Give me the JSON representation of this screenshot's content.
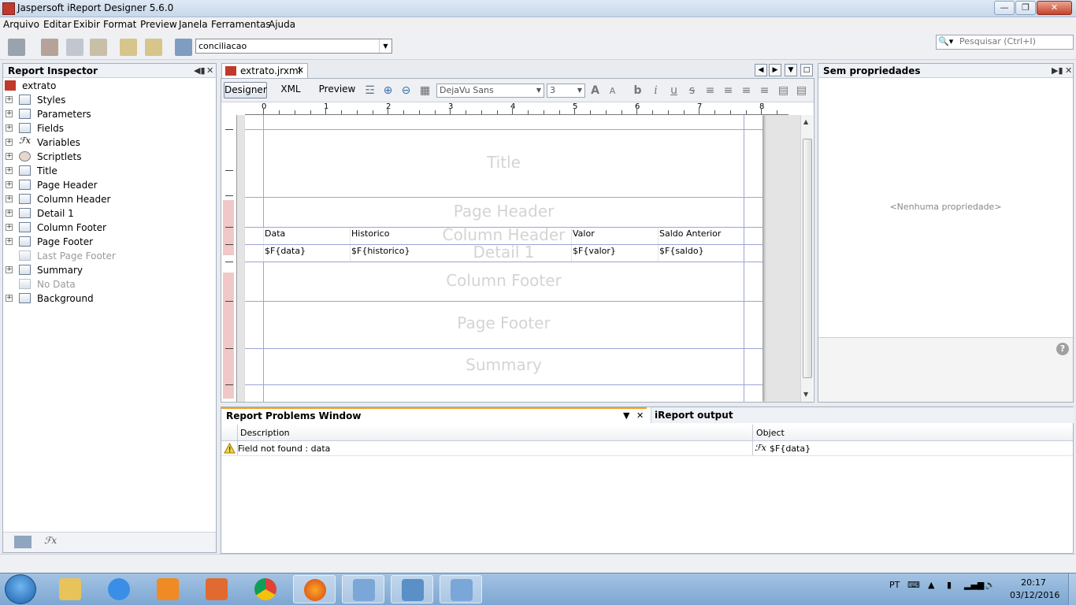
{
  "window": {
    "title": "Jaspersoft iReport Designer 5.6.0"
  },
  "menu": [
    "Arquivo",
    "Editar",
    "Exibir",
    "Format",
    "Preview",
    "Janela",
    "Ferramentas",
    "Ajuda"
  ],
  "toolbar": {
    "datasource_value": "conciliacao",
    "search_placeholder": "Pesquisar (Ctrl+I)"
  },
  "inspector": {
    "title": "Report Inspector",
    "root": "extrato",
    "items": [
      {
        "label": "Styles",
        "dim": false
      },
      {
        "label": "Parameters",
        "dim": false
      },
      {
        "label": "Fields",
        "dim": false
      },
      {
        "label": "Variables",
        "dim": false
      },
      {
        "label": "Scriptlets",
        "dim": false
      },
      {
        "label": "Title",
        "dim": false
      },
      {
        "label": "Page Header",
        "dim": false
      },
      {
        "label": "Column Header",
        "dim": false
      },
      {
        "label": "Detail 1",
        "dim": false
      },
      {
        "label": "Column Footer",
        "dim": false
      },
      {
        "label": "Page Footer",
        "dim": false
      },
      {
        "label": "Last Page Footer",
        "dim": true
      },
      {
        "label": "Summary",
        "dim": false
      },
      {
        "label": "No Data",
        "dim": true
      },
      {
        "label": "Background",
        "dim": false
      }
    ]
  },
  "editor": {
    "tab_title": "extrato.jrxml",
    "modes": [
      "Designer",
      "XML",
      "Preview"
    ],
    "font_name": "DejaVu Sans",
    "font_size": "3",
    "ruler_numbers": [
      "0",
      "1",
      "2",
      "3",
      "4",
      "5",
      "6",
      "7",
      "8"
    ],
    "bands": {
      "title": "Title",
      "page_header": "Page Header",
      "column_header": "Column Header",
      "detail": "Detail 1",
      "column_footer": "Column Footer",
      "page_footer": "Page Footer",
      "summary": "Summary"
    },
    "column_headers": [
      "Data",
      "Historico",
      "Valor",
      "Saldo Anterior"
    ],
    "detail_fields": [
      "$F{data}",
      "$F{historico}",
      "$F{valor}",
      "$F{saldo}"
    ]
  },
  "properties": {
    "title": "Sem propriedades",
    "empty_text": "<Nenhuma propriedade>"
  },
  "problems": {
    "title": "Report Problems Window",
    "output_tab": "iReport output",
    "columns": [
      "Description",
      "Object"
    ],
    "rows": [
      {
        "description": "Field not found : data",
        "object": "$F{data}"
      }
    ]
  },
  "taskbar": {
    "lang": "PT",
    "time": "20:17",
    "date": "03/12/2016"
  }
}
